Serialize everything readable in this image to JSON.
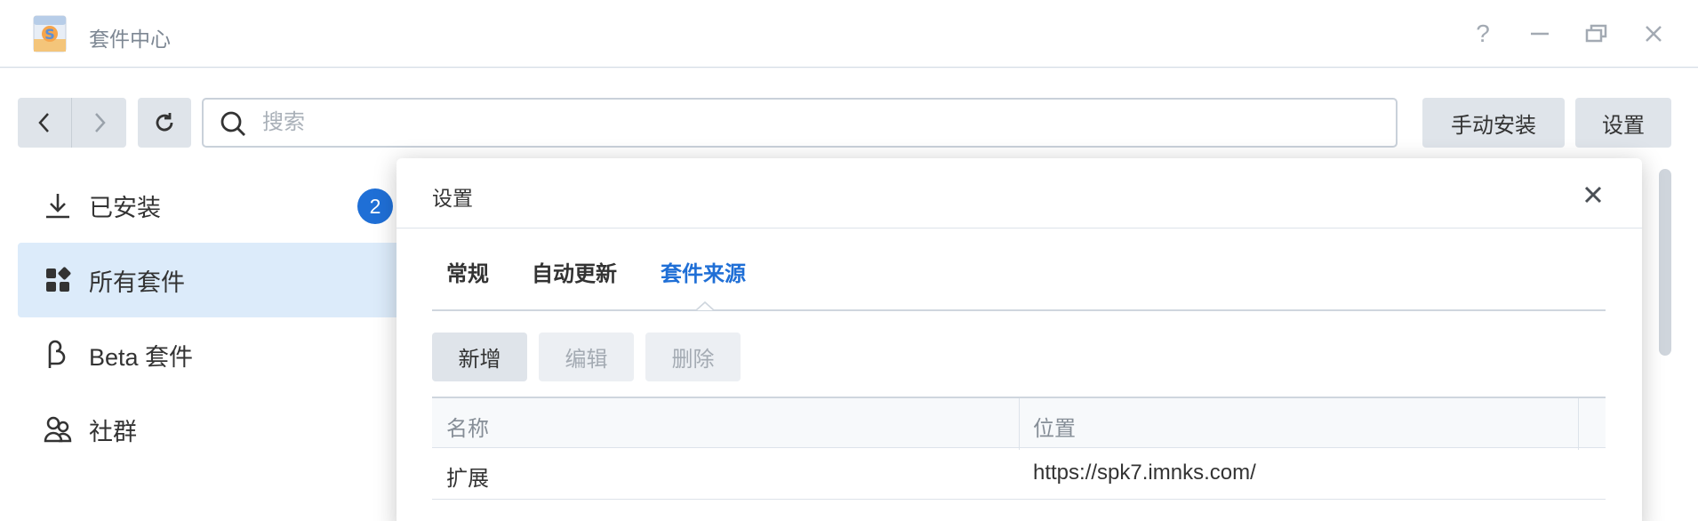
{
  "window": {
    "title": "套件中心",
    "help_glyph": "?"
  },
  "toolbar": {
    "search_placeholder": "搜索",
    "manual_install_label": "手动安装",
    "settings_label": "设置"
  },
  "sidebar": {
    "items": [
      {
        "label": "已安装",
        "icon": "download-icon",
        "badge": "2"
      },
      {
        "label": "所有套件",
        "icon": "grid-icon",
        "active": true
      },
      {
        "label": "Beta 套件",
        "icon": "beta-icon"
      },
      {
        "label": "社群",
        "icon": "community-icon"
      }
    ]
  },
  "dialog": {
    "title": "设置",
    "tabs": [
      {
        "label": "常规"
      },
      {
        "label": "自动更新"
      },
      {
        "label": "套件来源",
        "active": true
      }
    ],
    "actions": {
      "add_label": "新增",
      "edit_label": "编辑",
      "delete_label": "删除"
    },
    "table": {
      "columns": [
        "名称",
        "位置"
      ],
      "rows": [
        {
          "name": "扩展",
          "location": "https://spk7.imnks.com/"
        }
      ]
    }
  },
  "colors": {
    "accent": "#1f6fd6",
    "active_bg": "#dcebfa",
    "button_bg": "#dfe4ea"
  }
}
